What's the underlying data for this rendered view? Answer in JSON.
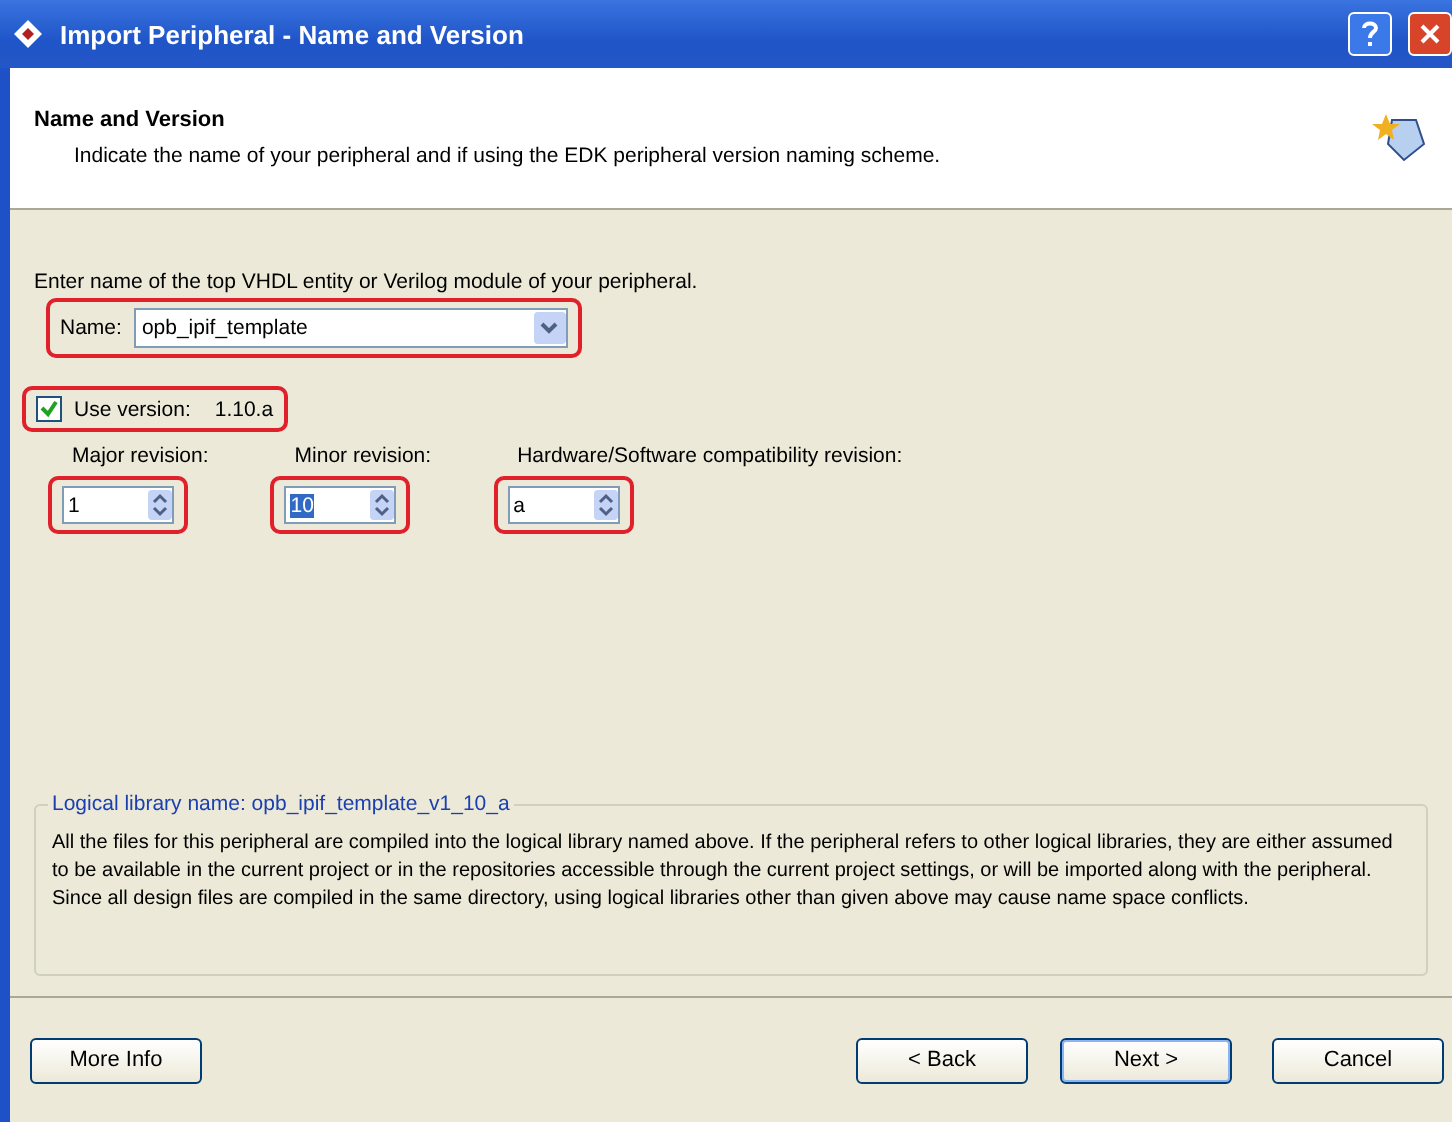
{
  "window": {
    "title": "Import Peripheral - Name and Version"
  },
  "header": {
    "title": "Name and Version",
    "subtitle": "Indicate the name of your peripheral and if using the EDK peripheral version naming scheme."
  },
  "prompt": "Enter name of the top VHDL entity or Verilog module of your peripheral.",
  "name_field": {
    "label": "Name:",
    "value": "opb_ipif_template",
    "highlighted": true
  },
  "use_version": {
    "label": "Use version:",
    "checked": true,
    "version": "1.10.a",
    "highlighted": true
  },
  "revisions": [
    {
      "label": "Major revision:",
      "value": "1",
      "selected": false,
      "highlighted": true
    },
    {
      "label": "Minor revision:",
      "value": "10",
      "selected": true,
      "highlighted": true
    },
    {
      "label": "Hardware/Software compatibility revision:",
      "value": "a",
      "selected": false,
      "highlighted": true
    }
  ],
  "library": {
    "legend": "Logical library name: opb_ipif_template_v1_10_a",
    "text": "All the files for this peripheral are compiled into the logical library named above. If the peripheral refers to other logical libraries, they are either assumed to be available in the current project or in the repositories accessible through the current project settings, or will be imported along with the peripheral. Since all design files are compiled in the same directory, using logical libraries other than given above may cause name space conflicts."
  },
  "buttons": [
    {
      "label": "More Info",
      "kind": "left"
    },
    {
      "label": "< Back",
      "kind": "right"
    },
    {
      "label": "Next >",
      "kind": "default"
    },
    {
      "label": "Cancel",
      "kind": "right"
    }
  ]
}
